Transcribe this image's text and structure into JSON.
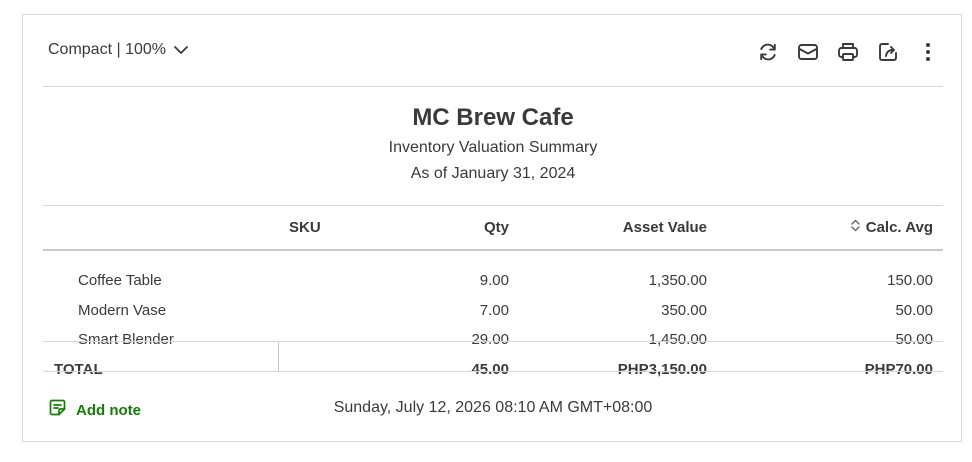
{
  "toolbar": {
    "view_label": "Compact | 100%",
    "icons": [
      "refresh-icon",
      "email-icon",
      "print-icon",
      "export-icon",
      "more-options-icon"
    ]
  },
  "report": {
    "company": "MC Brew Cafe",
    "name": "Inventory Valuation Summary",
    "date": "As of January 31, 2024"
  },
  "table": {
    "columns": [
      "SKU",
      "Qty",
      "Asset Value",
      "Calc. Avg"
    ],
    "rows": [
      {
        "name": "Coffee Table",
        "sku": "",
        "qty": "9.00",
        "asset_value": "1,350.00",
        "calc_avg": "150.00"
      },
      {
        "name": "Modern Vase",
        "sku": "",
        "qty": "7.00",
        "asset_value": "350.00",
        "calc_avg": "50.00"
      },
      {
        "name": "Smart Blender",
        "sku": "",
        "qty": "29.00",
        "asset_value": "1,450.00",
        "calc_avg": "50.00"
      }
    ],
    "total": {
      "label": "TOTAL",
      "qty": "45.00",
      "asset_value": "PHP3,150.00",
      "calc_avg": "PHP70.00"
    }
  },
  "footer": {
    "add_note_label": "Add note",
    "timestamp": "Sunday, July 12, 2026 08:10 AM GMT+08:00"
  },
  "colors": {
    "accent_green": "#108000",
    "text": "#393a3d",
    "border": "#d4d7dc"
  }
}
